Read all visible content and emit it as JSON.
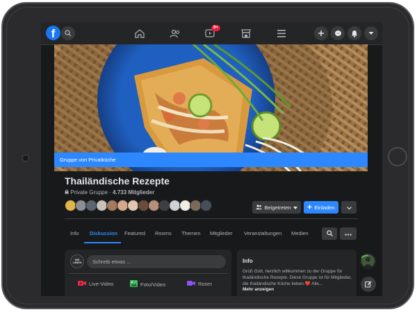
{
  "nav": {
    "notification_badge": "9+",
    "icons": [
      "facebook-logo",
      "search-icon",
      "home-icon",
      "friends-icon",
      "watch-icon",
      "marketplace-icon",
      "menu-icon",
      "plus-icon",
      "messenger-icon",
      "bell-icon",
      "account-dropdown-icon"
    ]
  },
  "cover": {
    "caption": "Gruppe von Privatküche"
  },
  "group": {
    "name": "Thailändische Rezepte",
    "privacy": "Private Gruppe",
    "separator": " · ",
    "members": "4.733 Mitglieder"
  },
  "buttons": {
    "joined": "Beigetreten",
    "invite": "Einladen"
  },
  "tabs": [
    "Info",
    "Diskussion",
    "Featured",
    "Rooms",
    "Themen",
    "Mitglieder",
    "Veranstaltungen",
    "Medien"
  ],
  "active_tab": "Diskussion",
  "composer": {
    "placeholder": "Schreib etwas ...",
    "avatar_text": "WIR LIEBEN",
    "actions": {
      "live": "Live-Video",
      "photo": "Foto/Video",
      "room": "Room"
    }
  },
  "info": {
    "title": "Info",
    "text": "Grüß Gott, herzlich willkommen zu der Gruppe für thailändische Rezepte. Diese Gruppe ist für Mitglieder, die thailändische Küche lieben.❤️ Alle...",
    "more": "Mehr anzeigen"
  },
  "colors": {
    "accent": "#2d88ff",
    "background": "#18191a",
    "surface": "#242526",
    "badge": "#e41e3f"
  }
}
